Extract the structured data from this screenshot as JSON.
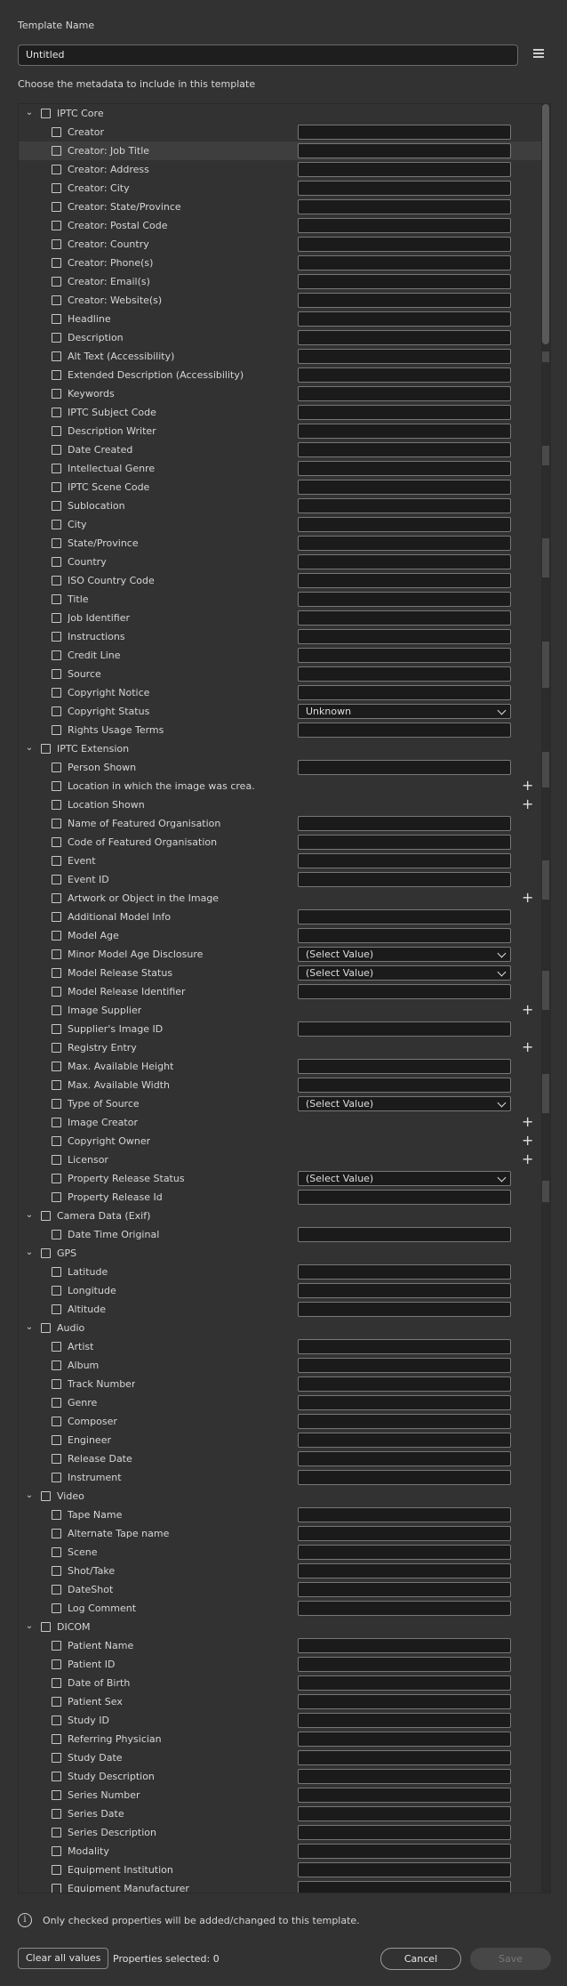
{
  "template_name_label": "Template Name",
  "template_name_value": "Untitled",
  "choose_label": "Choose the metadata to include in this template",
  "groups": [
    {
      "label": "IPTC Core",
      "items": [
        {
          "label": "Creator",
          "control": "field"
        },
        {
          "label": "Creator: Job Title",
          "control": "field",
          "highlight": true
        },
        {
          "label": "Creator: Address",
          "control": "field"
        },
        {
          "label": "Creator: City",
          "control": "field"
        },
        {
          "label": "Creator: State/Province",
          "control": "field"
        },
        {
          "label": "Creator: Postal Code",
          "control": "field"
        },
        {
          "label": "Creator: Country",
          "control": "field"
        },
        {
          "label": "Creator: Phone(s)",
          "control": "field"
        },
        {
          "label": "Creator: Email(s)",
          "control": "field"
        },
        {
          "label": "Creator: Website(s)",
          "control": "field"
        },
        {
          "label": "Headline",
          "control": "field"
        },
        {
          "label": "Description",
          "control": "field"
        },
        {
          "label": "Alt Text (Accessibility)",
          "control": "field"
        },
        {
          "label": "Extended Description (Accessibility)",
          "control": "field"
        },
        {
          "label": "Keywords",
          "control": "field"
        },
        {
          "label": "IPTC Subject Code",
          "control": "field"
        },
        {
          "label": "Description Writer",
          "control": "field"
        },
        {
          "label": "Date Created",
          "control": "field"
        },
        {
          "label": "Intellectual Genre",
          "control": "field"
        },
        {
          "label": "IPTC Scene Code",
          "control": "field"
        },
        {
          "label": "Sublocation",
          "control": "field"
        },
        {
          "label": "City",
          "control": "field"
        },
        {
          "label": "State/Province",
          "control": "field"
        },
        {
          "label": "Country",
          "control": "field"
        },
        {
          "label": "ISO Country Code",
          "control": "field"
        },
        {
          "label": "Title",
          "control": "field"
        },
        {
          "label": "Job Identifier",
          "control": "field"
        },
        {
          "label": "Instructions",
          "control": "field"
        },
        {
          "label": "Credit Line",
          "control": "field"
        },
        {
          "label": "Source",
          "control": "field"
        },
        {
          "label": "Copyright Notice",
          "control": "field"
        },
        {
          "label": "Copyright Status",
          "control": "select",
          "value": "Unknown"
        },
        {
          "label": "Rights Usage Terms",
          "control": "field"
        }
      ]
    },
    {
      "label": "IPTC Extension",
      "items": [
        {
          "label": "Person Shown",
          "control": "field"
        },
        {
          "label": "Location in which the image was crea...",
          "control": "plus"
        },
        {
          "label": "Location Shown",
          "control": "plus"
        },
        {
          "label": "Name of Featured Organisation",
          "control": "field"
        },
        {
          "label": "Code of Featured Organisation",
          "control": "field"
        },
        {
          "label": "Event",
          "control": "field"
        },
        {
          "label": "Event ID",
          "control": "field"
        },
        {
          "label": "Artwork or Object in the Image",
          "control": "plus"
        },
        {
          "label": "Additional Model Info",
          "control": "field"
        },
        {
          "label": "Model Age",
          "control": "field"
        },
        {
          "label": "Minor Model Age Disclosure",
          "control": "select",
          "value": "(Select Value)"
        },
        {
          "label": "Model Release Status",
          "control": "select",
          "value": "(Select Value)"
        },
        {
          "label": "Model Release Identifier",
          "control": "field"
        },
        {
          "label": "Image Supplier",
          "control": "plus"
        },
        {
          "label": "Supplier's Image ID",
          "control": "field"
        },
        {
          "label": "Registry Entry",
          "control": "plus"
        },
        {
          "label": "Max. Available Height",
          "control": "field"
        },
        {
          "label": "Max. Available Width",
          "control": "field"
        },
        {
          "label": "Type of Source",
          "control": "select",
          "value": "(Select Value)"
        },
        {
          "label": "Image Creator",
          "control": "plus"
        },
        {
          "label": "Copyright Owner",
          "control": "plus"
        },
        {
          "label": "Licensor",
          "control": "plus"
        },
        {
          "label": "Property Release Status",
          "control": "select",
          "value": "(Select Value)"
        },
        {
          "label": "Property Release Id",
          "control": "field"
        }
      ]
    },
    {
      "label": "Camera Data (Exif)",
      "items": [
        {
          "label": "Date Time Original",
          "control": "field"
        }
      ]
    },
    {
      "label": "GPS",
      "items": [
        {
          "label": "Latitude",
          "control": "field"
        },
        {
          "label": "Longitude",
          "control": "field"
        },
        {
          "label": "Altitude",
          "control": "field"
        }
      ]
    },
    {
      "label": "Audio",
      "items": [
        {
          "label": "Artist",
          "control": "field"
        },
        {
          "label": "Album",
          "control": "field"
        },
        {
          "label": "Track Number",
          "control": "field"
        },
        {
          "label": "Genre",
          "control": "field"
        },
        {
          "label": "Composer",
          "control": "field"
        },
        {
          "label": "Engineer",
          "control": "field"
        },
        {
          "label": "Release Date",
          "control": "field"
        },
        {
          "label": "Instrument",
          "control": "field"
        }
      ]
    },
    {
      "label": "Video",
      "items": [
        {
          "label": "Tape Name",
          "control": "field"
        },
        {
          "label": "Alternate Tape name",
          "control": "field"
        },
        {
          "label": "Scene",
          "control": "field"
        },
        {
          "label": "Shot/Take",
          "control": "field"
        },
        {
          "label": "DateShot",
          "control": "field"
        },
        {
          "label": "Log Comment",
          "control": "field"
        }
      ]
    },
    {
      "label": "DICOM",
      "items": [
        {
          "label": "Patient Name",
          "control": "field"
        },
        {
          "label": "Patient ID",
          "control": "field"
        },
        {
          "label": "Date of Birth",
          "control": "field"
        },
        {
          "label": "Patient Sex",
          "control": "field"
        },
        {
          "label": "Study ID",
          "control": "field"
        },
        {
          "label": "Referring Physician",
          "control": "field"
        },
        {
          "label": "Study Date",
          "control": "field"
        },
        {
          "label": "Study Description",
          "control": "field"
        },
        {
          "label": "Series Number",
          "control": "field"
        },
        {
          "label": "Series Date",
          "control": "field"
        },
        {
          "label": "Series Description",
          "control": "field"
        },
        {
          "label": "Modality",
          "control": "field"
        },
        {
          "label": "Equipment Institution",
          "control": "field"
        },
        {
          "label": "Equipment Manufacturer",
          "control": "field"
        }
      ]
    }
  ],
  "info_text": "Only checked properties will be added/changed to this template.",
  "clear_label": "Clear all values",
  "props_selected": "Properties selected: 0",
  "cancel_label": "Cancel",
  "save_label": "Save"
}
